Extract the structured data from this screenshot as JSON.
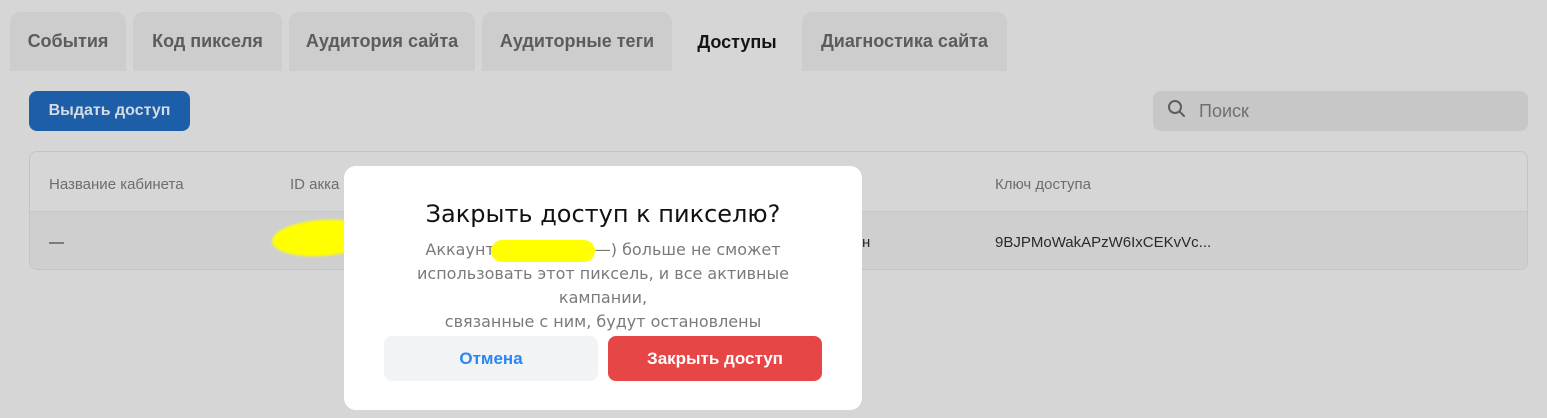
{
  "tabs": [
    {
      "label": "События",
      "active": false
    },
    {
      "label": "Код пикселя",
      "active": false
    },
    {
      "label": "Аудитория сайта",
      "active": false
    },
    {
      "label": "Аудиторные теги",
      "active": false
    },
    {
      "label": "Доступы",
      "active": true
    },
    {
      "label": "Диагностика сайта",
      "active": false
    }
  ],
  "toolbar": {
    "grant_label": "Выдать доступ",
    "search_placeholder": "Поиск",
    "search_icon": "search-icon"
  },
  "table": {
    "headers": {
      "cabinet_name": "Название кабинета",
      "account_id": "ID акка",
      "access_key": "Ключ доступа"
    },
    "rows": [
      {
        "cabinet_name": "—",
        "role_tail": "н",
        "access_key": "9BJPMoWakAPzW6IxCEKvVc..."
      }
    ]
  },
  "modal": {
    "title": "Закрыть доступ к пикселю?",
    "text_line1_pre": "Аккаунт",
    "text_line1_post": "—) больше не сможет",
    "text_line2": "использовать этот пиксель, и все активные кампании,",
    "text_line3": "связанные с ним, будут остановлены",
    "cancel_label": "Отмена",
    "confirm_label": "Закрыть доступ"
  },
  "colors": {
    "accent": "#2787f5",
    "danger": "#e64646",
    "redaction": "#ffff00"
  }
}
